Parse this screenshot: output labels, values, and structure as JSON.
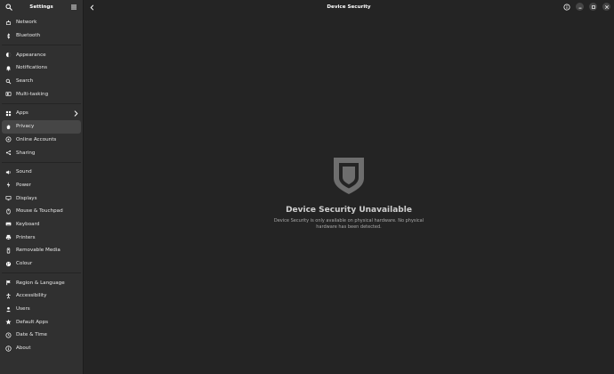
{
  "sidebar": {
    "title": "Settings",
    "groups": [
      [
        {
          "label": "Network",
          "icon": "network-icon"
        },
        {
          "label": "Bluetooth",
          "icon": "bluetooth-icon"
        }
      ],
      [
        {
          "label": "Appearance",
          "icon": "appearance-icon"
        },
        {
          "label": "Notifications",
          "icon": "bell-icon"
        },
        {
          "label": "Search",
          "icon": "search-icon"
        },
        {
          "label": "Multi-tasking",
          "icon": "multitasking-icon"
        }
      ],
      [
        {
          "label": "Apps",
          "icon": "apps-icon"
        },
        {
          "label": "Privacy",
          "icon": "hand-icon"
        },
        {
          "label": "Online Accounts",
          "icon": "online-accounts-icon"
        },
        {
          "label": "Sharing",
          "icon": "share-icon"
        }
      ],
      [
        {
          "label": "Sound",
          "icon": "speaker-icon"
        },
        {
          "label": "Power",
          "icon": "power-icon"
        },
        {
          "label": "Displays",
          "icon": "display-icon"
        },
        {
          "label": "Mouse & Touchpad",
          "icon": "mouse-icon"
        },
        {
          "label": "Keyboard",
          "icon": "keyboard-icon"
        },
        {
          "label": "Printers",
          "icon": "printer-icon"
        },
        {
          "label": "Removable Media",
          "icon": "usb-icon"
        },
        {
          "label": "Colour",
          "icon": "palette-icon"
        }
      ],
      [
        {
          "label": "Region & Language",
          "icon": "flag-icon"
        },
        {
          "label": "Accessibility",
          "icon": "accessibility-icon"
        },
        {
          "label": "Users",
          "icon": "users-icon"
        },
        {
          "label": "Default Apps",
          "icon": "star-icon"
        },
        {
          "label": "Date & Time",
          "icon": "clock-icon"
        },
        {
          "label": "About",
          "icon": "info-icon"
        }
      ]
    ],
    "selected": "Privacy"
  },
  "header": {
    "title": "Device Security"
  },
  "empty_state": {
    "title": "Device Security Unavailable",
    "description": "Device Security is only available on physical hardware. No physical hardware has been detected."
  },
  "colors": {
    "background": "#242424",
    "sidebar": "#303030",
    "selected": "#464646",
    "shield": "#6e6e6e"
  }
}
